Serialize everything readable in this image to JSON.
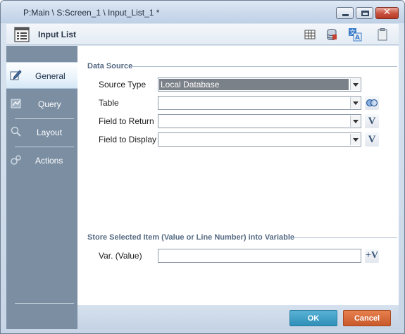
{
  "window": {
    "title": "P:Main \\ S:Screen_1 \\ Input_List_1 *",
    "controls": {
      "minimize": "minimize",
      "maximize": "maximize",
      "close": "✕"
    }
  },
  "header": {
    "title": "Input List",
    "tools": [
      "table-grid-icon",
      "database-icon",
      "translate-icon",
      "clipboard-icon"
    ]
  },
  "sidebar": {
    "items": [
      {
        "label": "General",
        "icon": "edit-icon",
        "active": true
      },
      {
        "label": "Query",
        "icon": "query-icon",
        "active": false
      },
      {
        "label": "Layout",
        "icon": "layout-icon",
        "active": false
      },
      {
        "label": "Actions",
        "icon": "actions-icon",
        "active": false
      }
    ]
  },
  "data_source": {
    "heading": "Data Source",
    "source_type": {
      "label": "Source Type",
      "value": "Local Database"
    },
    "table": {
      "label": "Table",
      "value": ""
    },
    "field_to_return": {
      "label": "Field to Return",
      "value": ""
    },
    "field_to_display": {
      "label": "Field to Display",
      "value": ""
    },
    "variable_button_glyph": "V"
  },
  "store": {
    "heading": "Store Selected Item (Value or Line Number) into Variable",
    "var_value": {
      "label": "Var. (Value)",
      "value": ""
    },
    "add_variable_glyph": "+V"
  },
  "footer": {
    "ok_label": "OK",
    "cancel_label": "Cancel"
  },
  "colors": {
    "accent_ok": "#2f8fb8",
    "accent_cancel": "#c8582a",
    "sidebar": "#7b8ea2",
    "section_title": "#556a83"
  }
}
